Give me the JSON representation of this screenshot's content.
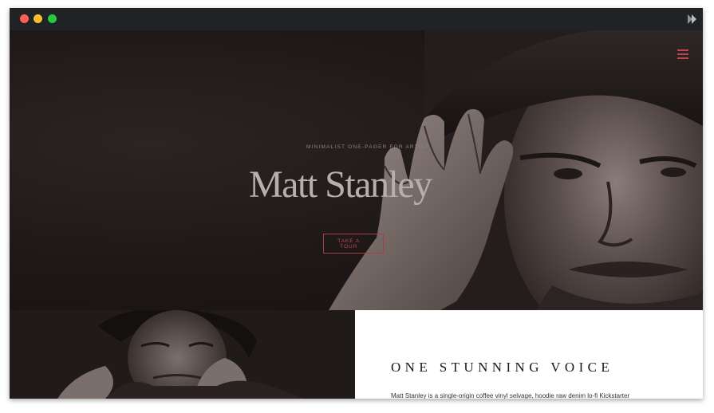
{
  "hero": {
    "kicker": "MINIMALIST ONE-PAGER FOR ARTIST",
    "title": "Matt Stanley",
    "cta_label": "TAKE A TOUR",
    "cta_arrow": "→"
  },
  "about": {
    "heading": "ONE STUNNING VOICE",
    "text": "Matt Stanley is a single-origin coffee vinyl selvage, hoodie raw denim lo-fi Kickstarter"
  },
  "colors": {
    "accent": "#c0414f",
    "hero_bg": "#1d1716",
    "title_text": "#b6b0ad"
  },
  "icons": {
    "menu": "hamburger-menu-icon",
    "brand": "brand-logo-icon"
  }
}
